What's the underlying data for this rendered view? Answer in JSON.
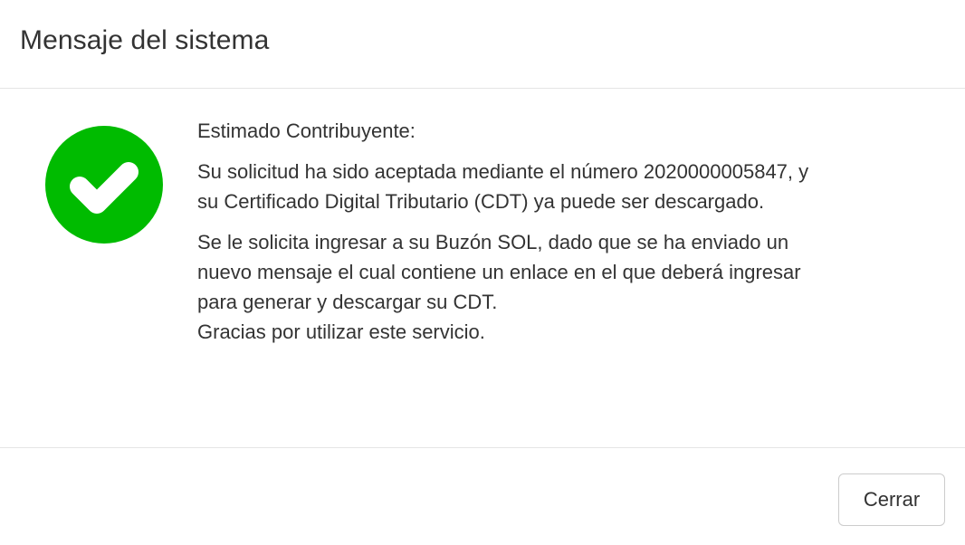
{
  "dialog": {
    "title": "Mensaje del sistema",
    "icon": "check-circle-icon",
    "icon_color": "#00bb00",
    "greeting": "Estimado Contribuyente:",
    "paragraph1": {
      "line1": "Su solicitud ha sido aceptada mediante el número 2020000005847, y",
      "line2": "su Certificado Digital Tributario (CDT) ya puede ser descargado."
    },
    "paragraph2": {
      "line1": "Se le solicita ingresar a su Buzón SOL, dado que se ha enviado un",
      "line2": "nuevo mensaje el cual contiene un enlace en el que deberá ingresar",
      "line3": "para generar y descargar su CDT.",
      "line4": "Gracias por utilizar este servicio."
    },
    "close_label": "Cerrar"
  }
}
